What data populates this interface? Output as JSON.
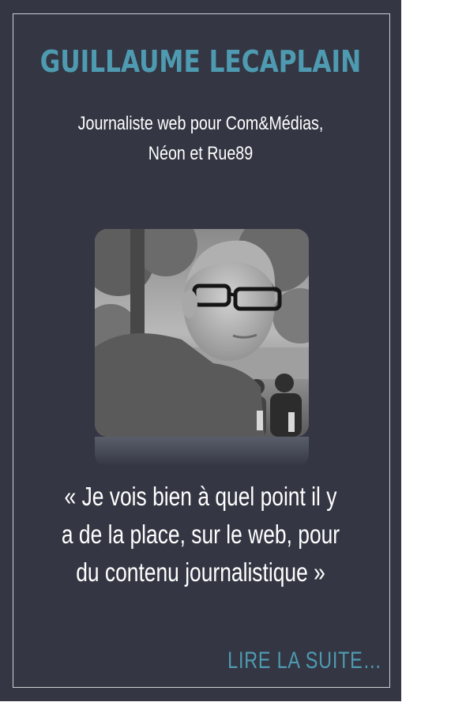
{
  "profile": {
    "name": "GUILLAUME LECAPLAIN",
    "role_lines": [
      "Journaliste web pour Com&Médias,",
      "Néon et Rue89"
    ]
  },
  "quote": {
    "lines": [
      "« Je vois bien à quel point il y",
      "a de la place, sur le web, pour",
      "du contenu journalistique »"
    ]
  },
  "cta": {
    "read_more_label": "LIRE LA SUITE…"
  },
  "colors": {
    "card_background": "#343643",
    "accent": "#4e9bb1",
    "text": "#ffffff"
  }
}
